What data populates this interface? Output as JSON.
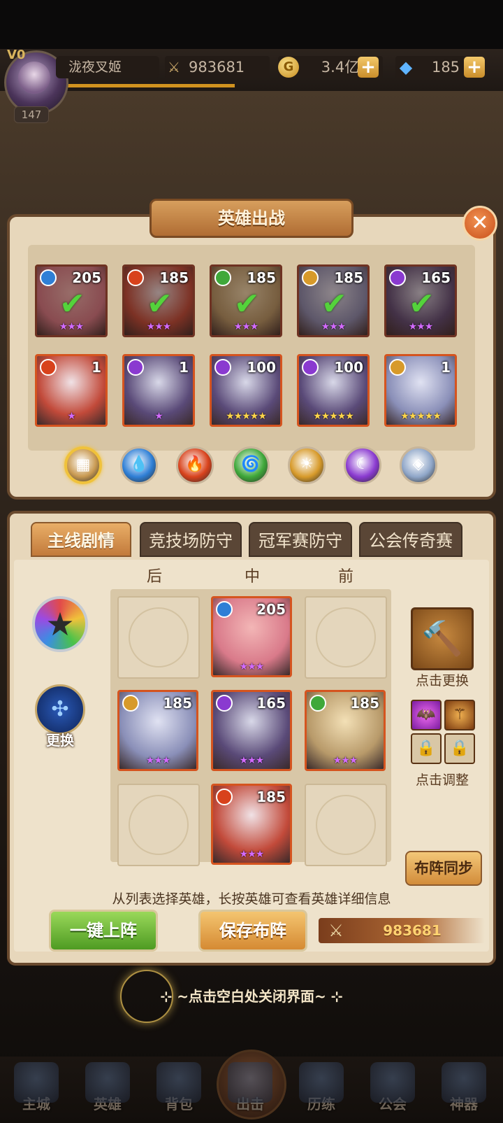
{
  "player": {
    "vip": "V0",
    "level": "147",
    "name": "泷夜叉姬",
    "power": "983681",
    "gold": "3.4亿",
    "gems": "185"
  },
  "dialog": {
    "title": "英雄出战",
    "close": "✕"
  },
  "roster": [
    {
      "level": "205",
      "element": "water",
      "stars": 3,
      "deployed": true
    },
    {
      "level": "185",
      "element": "fire",
      "stars": 3,
      "deployed": true
    },
    {
      "level": "185",
      "element": "wind",
      "stars": 3,
      "deployed": true
    },
    {
      "level": "185",
      "element": "light",
      "stars": 3,
      "deployed": true
    },
    {
      "level": "165",
      "element": "dark",
      "stars": 3,
      "deployed": true
    },
    {
      "level": "1",
      "element": "fire",
      "stars": 1,
      "deployed": false
    },
    {
      "level": "1",
      "element": "dark",
      "stars": 1,
      "deployed": false
    },
    {
      "level": "100",
      "element": "dark",
      "stars": 5,
      "deployed": false
    },
    {
      "level": "100",
      "element": "dark",
      "stars": 5,
      "deployed": false
    },
    {
      "level": "1",
      "element": "light",
      "stars": 5,
      "deployed": false
    }
  ],
  "filters": [
    "all",
    "water",
    "fire",
    "wind",
    "light",
    "dark",
    "special"
  ],
  "colors": {
    "water": "#2f7fd6",
    "fire": "#d8421c",
    "wind": "#3fa83a",
    "light": "#d79a2a",
    "dark": "#8a3ad0",
    "special": "#8fa6c8",
    "all": "#c99a52"
  },
  "tabs": [
    "主线剧情",
    "竞技场防守",
    "冠军赛防守",
    "公会传奇赛"
  ],
  "columns": [
    "后",
    "中",
    "前"
  ],
  "formation": {
    "swap_label": "更换"
  },
  "grid": [
    {
      "level": "205",
      "element": "water",
      "stars": 3
    },
    {
      "level": "185",
      "element": "light",
      "stars": 3
    },
    {
      "level": "165",
      "element": "dark",
      "stars": 3
    },
    {
      "level": "185",
      "element": "wind",
      "stars": 3
    },
    {
      "level": "185",
      "element": "fire",
      "stars": 3
    }
  ],
  "side": {
    "weapon_label": "点击更换",
    "adjust_label": "点击调整",
    "sync": "布阵同步"
  },
  "hint": "从列表选择英雄，长按英雄可查看英雄详细信息",
  "buttons": {
    "auto": "一键上阵",
    "save": "保存布阵"
  },
  "team_power": "983681",
  "close_hint": "点击空白处关闭界面",
  "nav": [
    "主城",
    "英雄",
    "背包",
    "出击",
    "历练",
    "公会",
    "神器"
  ]
}
